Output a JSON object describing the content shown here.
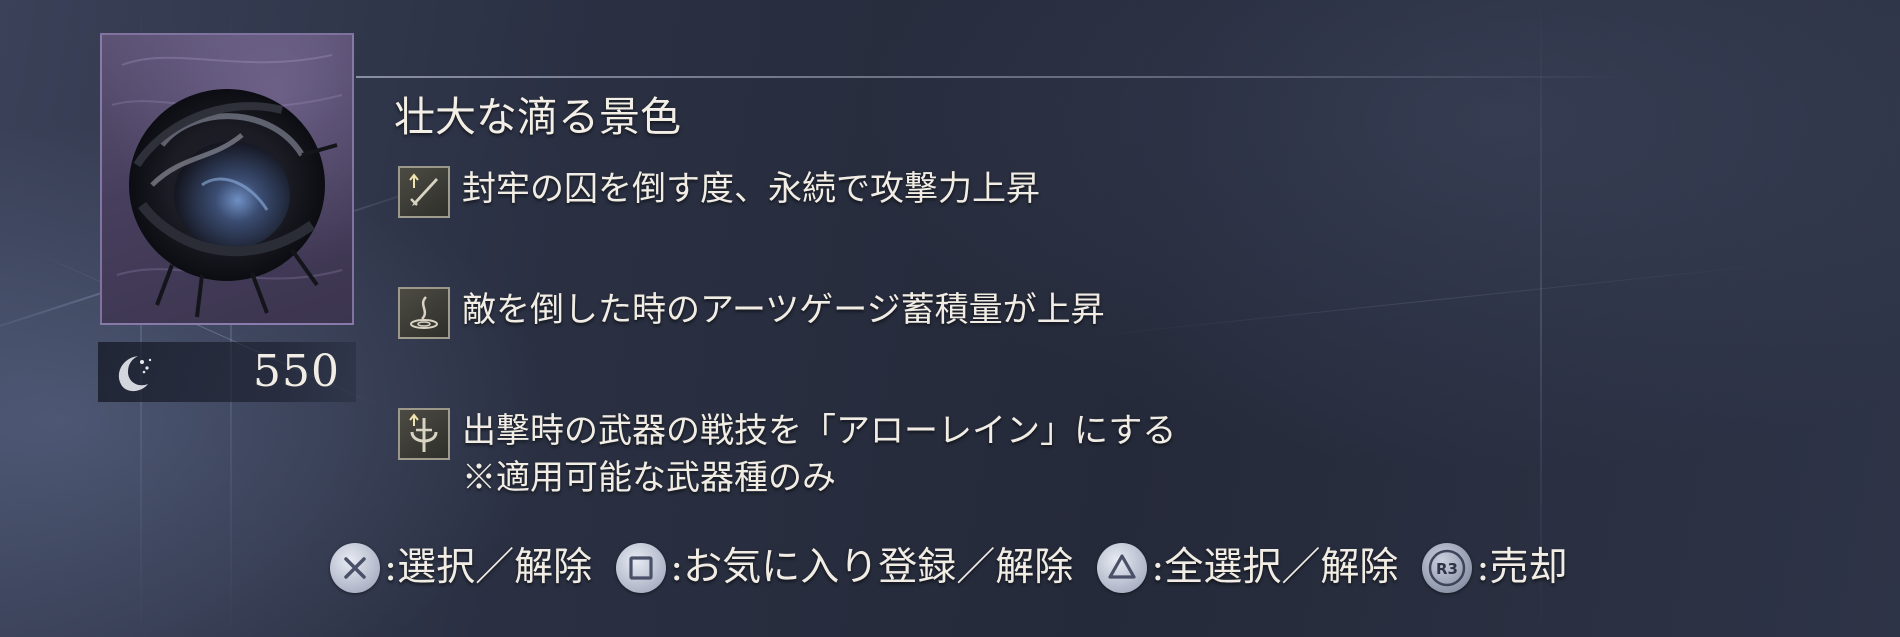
{
  "item": {
    "name": "壮大な滴る景色",
    "price": "550",
    "currency_icon": "murk-currency-icon",
    "image_icon": "dark-thorny-orb-icon"
  },
  "effects": [
    {
      "icon": "sword-attack-up-icon",
      "lines": [
        "封牢の囚を倒す度、永続で攻撃力上昇"
      ]
    },
    {
      "icon": "art-gauge-drop-icon",
      "lines": [
        "敵を倒した時のアーツゲージ蓄積量が上昇"
      ]
    },
    {
      "icon": "weapon-skill-icon",
      "lines": [
        "出撃時の武器の戦技を「アローレイン」にする",
        "※適用可能な武器種のみ"
      ]
    }
  ],
  "prompts": [
    {
      "button": "×",
      "icon": "cross-button-icon",
      "label": ":選択／解除"
    },
    {
      "button": "□",
      "icon": "square-button-icon",
      "label": ":お気に入り登録／解除"
    },
    {
      "button": "△",
      "icon": "triangle-button-icon",
      "label": ":全選択／解除"
    },
    {
      "button": "R3",
      "icon": "r3-button-icon",
      "label": ":売却"
    }
  ],
  "colors": {
    "background": "#262b3c",
    "card_frame": "#968bb9",
    "text": "#f1ede4"
  }
}
